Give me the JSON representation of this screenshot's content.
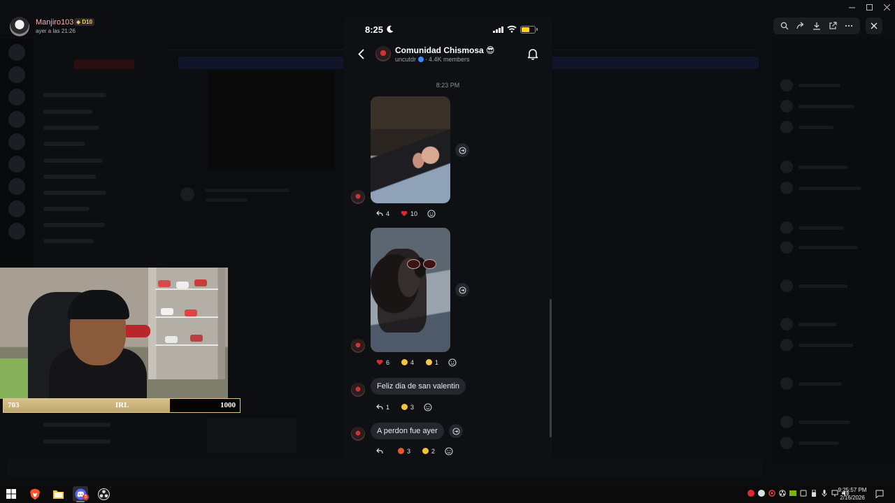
{
  "poster": {
    "name": "Manjiro103",
    "badge": "D10",
    "time": "ayer a las 21:26"
  },
  "phone": {
    "status_bar": {
      "time": "8:25"
    },
    "header": {
      "group_name": "Comunidad Chismosa 😎",
      "handle": "uncutdr",
      "members": "4.4K members"
    },
    "timestamp": "8:23 PM",
    "messages": [
      {
        "type": "photo",
        "reactions": [
          {
            "icon": "reply-icon",
            "count": "4"
          },
          {
            "icon": "heart-emoji",
            "count": "10"
          }
        ]
      },
      {
        "type": "photo",
        "reactions": [
          {
            "icon": "heart-emoji",
            "count": "6"
          },
          {
            "icon": "laughing-emoji",
            "count": "4"
          },
          {
            "icon": "smile-emoji",
            "count": "1"
          }
        ]
      },
      {
        "type": "text",
        "text": "Feliz dia de san valentin",
        "reactions": [
          {
            "icon": "reply-icon",
            "count": "1"
          },
          {
            "icon": "laughing-emoji",
            "count": "3"
          }
        ]
      },
      {
        "type": "text",
        "text": "A perdon fue ayer",
        "reactions": [
          {
            "icon": "reply-icon",
            "count": ""
          },
          {
            "icon": "angry-emoji",
            "count": "3"
          },
          {
            "icon": "laughing-emoji",
            "count": "2"
          }
        ]
      }
    ]
  },
  "goal": {
    "current": "703",
    "label": "IRL",
    "target": "1000",
    "progress": 0.703
  },
  "taskbar": {
    "apps": [
      "windows-start",
      "brave-browser",
      "file-explorer",
      "discord",
      "obs-studio"
    ],
    "discord_badge": "5",
    "clock_time": "9:25:57 PM",
    "clock_date": "2/16/2026"
  },
  "colors": {
    "accent_gold": "#d8c08a",
    "phone_bg": "#0e1014",
    "bubble_bg": "#24272d",
    "verified_blue": "#3d8bfd",
    "heart_red": "#e0262f",
    "discord_blurple": "#5865f2"
  }
}
